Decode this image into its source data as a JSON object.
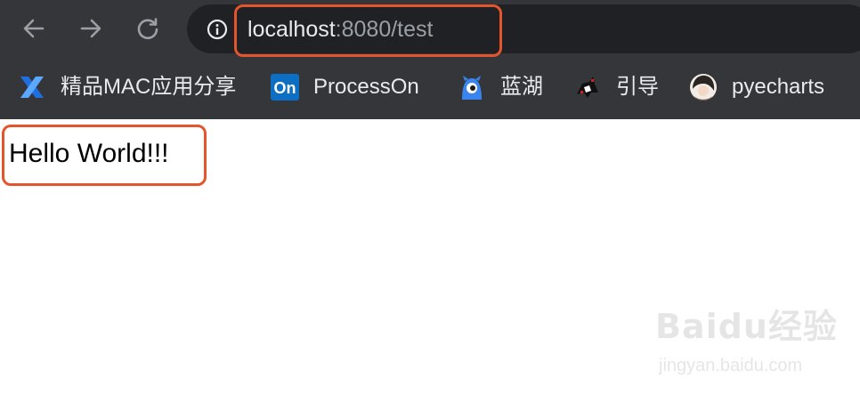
{
  "toolbar": {
    "back_icon": "arrow-left-icon",
    "forward_icon": "arrow-right-icon",
    "reload_icon": "reload-icon",
    "info_icon": "info-icon"
  },
  "address_bar": {
    "host": "localhost",
    "rest": ":8080/test",
    "highlight_color": "#e4552d"
  },
  "bookmarks": [
    {
      "label": "精品MAC应用分享",
      "icon": "x-logo-icon"
    },
    {
      "label": "ProcessOn",
      "icon": "on-logo-icon",
      "icon_text": "On"
    },
    {
      "label": "蓝湖",
      "icon": "lanhu-logo-icon"
    },
    {
      "label": "引导",
      "icon": "penguin-icon"
    },
    {
      "label": "pyecharts",
      "icon": "avatar-icon"
    }
  ],
  "page": {
    "text": "Hello World!!!",
    "highlight_color": "#e4552d"
  },
  "watermark": {
    "logo": "Baidu经验",
    "url": "jingyan.baidu.com"
  },
  "colors": {
    "toolbar_bg": "#35363a",
    "omnibox_bg": "#202124",
    "text_light": "#e8eaed",
    "text_dim": "#9aa0a6"
  }
}
